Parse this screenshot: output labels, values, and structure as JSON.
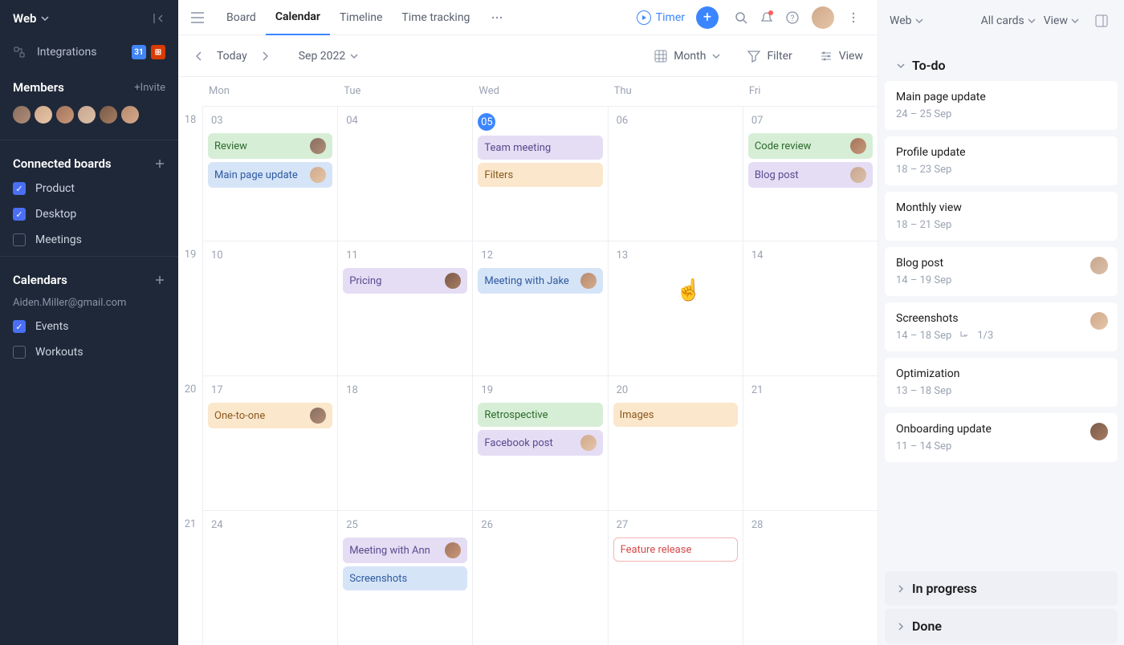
{
  "sidebar": {
    "workspace": "Web",
    "integrations_label": "Integrations",
    "members_label": "Members",
    "invite_label": "+Invite",
    "connected_boards_label": "Connected boards",
    "boards": [
      {
        "label": "Product",
        "checked": true
      },
      {
        "label": "Desktop",
        "checked": true
      },
      {
        "label": "Meetings",
        "checked": false
      }
    ],
    "calendars_label": "Calendars",
    "calendar_email": "Aiden.Miller@gmail.com",
    "calendars": [
      {
        "label": "Events",
        "checked": true
      },
      {
        "label": "Workouts",
        "checked": false
      }
    ]
  },
  "topbar": {
    "tabs": [
      "Board",
      "Calendar",
      "Timeline",
      "Time tracking"
    ],
    "active_tab": "Calendar",
    "timer_label": "Timer"
  },
  "subbar": {
    "today_label": "Today",
    "period_label": "Sep 2022",
    "view_mode": "Month",
    "filter_label": "Filter",
    "view_label": "View"
  },
  "calendar": {
    "dow": [
      "Mon",
      "Tue",
      "Wed",
      "Thu",
      "Fri"
    ],
    "weeks": [
      {
        "num": "18",
        "days": [
          {
            "num": "03",
            "events": [
              {
                "t": "Review",
                "c": "green",
                "av": 1
              },
              {
                "t": "Main page update",
                "c": "blue",
                "av": 2
              }
            ]
          },
          {
            "num": "04",
            "events": []
          },
          {
            "num": "05",
            "today": true,
            "events": [
              {
                "t": "Team meeting",
                "c": "purple"
              },
              {
                "t": "Filters",
                "c": "orange"
              }
            ]
          },
          {
            "num": "06",
            "events": []
          },
          {
            "num": "07",
            "events": [
              {
                "t": "Code review",
                "c": "green",
                "av": 3
              },
              {
                "t": "Blog post",
                "c": "purple",
                "av": 4
              }
            ]
          }
        ]
      },
      {
        "num": "19",
        "days": [
          {
            "num": "10",
            "events": []
          },
          {
            "num": "11",
            "events": [
              {
                "t": "Pricing",
                "c": "purple",
                "av": 5
              }
            ]
          },
          {
            "num": "12",
            "events": [
              {
                "t": "Meeting with Jake",
                "c": "blue",
                "av": 6
              }
            ]
          },
          {
            "num": "13",
            "events": [],
            "cursor": true
          },
          {
            "num": "14",
            "events": []
          }
        ]
      },
      {
        "num": "20",
        "days": [
          {
            "num": "17",
            "events": [
              {
                "t": "One-to-one",
                "c": "orange",
                "av": 1
              }
            ]
          },
          {
            "num": "18",
            "events": []
          },
          {
            "num": "19",
            "events": [
              {
                "t": "Retrospective",
                "c": "green"
              },
              {
                "t": "Facebook post",
                "c": "purple",
                "av": 2
              }
            ]
          },
          {
            "num": "20",
            "events": [
              {
                "t": "Images",
                "c": "orange"
              }
            ]
          },
          {
            "num": "21",
            "events": []
          }
        ]
      },
      {
        "num": "21",
        "days": [
          {
            "num": "24",
            "events": []
          },
          {
            "num": "25",
            "events": [
              {
                "t": "Meeting with Ann",
                "c": "purple",
                "av": 3
              },
              {
                "t": "Screenshots",
                "c": "blue"
              }
            ]
          },
          {
            "num": "26",
            "events": []
          },
          {
            "num": "27",
            "events": [
              {
                "t": "Feature release",
                "c": "red"
              }
            ]
          },
          {
            "num": "28",
            "events": []
          }
        ]
      }
    ]
  },
  "panel": {
    "workspace": "Web",
    "allcards_label": "All cards",
    "view_label": "View",
    "sections": {
      "todo": "To-do",
      "inprogress": "In progress",
      "done": "Done"
    },
    "cards": [
      {
        "title": "Main page update",
        "date": "24 – 25 Sep"
      },
      {
        "title": "Profile update",
        "date": "18 – 23 Sep"
      },
      {
        "title": "Monthly view",
        "date": "18 – 21 Sep"
      },
      {
        "title": "Blog post",
        "date": "14 – 19 Sep",
        "av": 4
      },
      {
        "title": "Screenshots",
        "date": "14 – 18 Sep",
        "sub": "1/3",
        "av": 2
      },
      {
        "title": "Optimization",
        "date": "13 – 18 Sep"
      },
      {
        "title": "Onboarding update",
        "date": "11 – 14 Sep",
        "av": 5
      }
    ]
  }
}
